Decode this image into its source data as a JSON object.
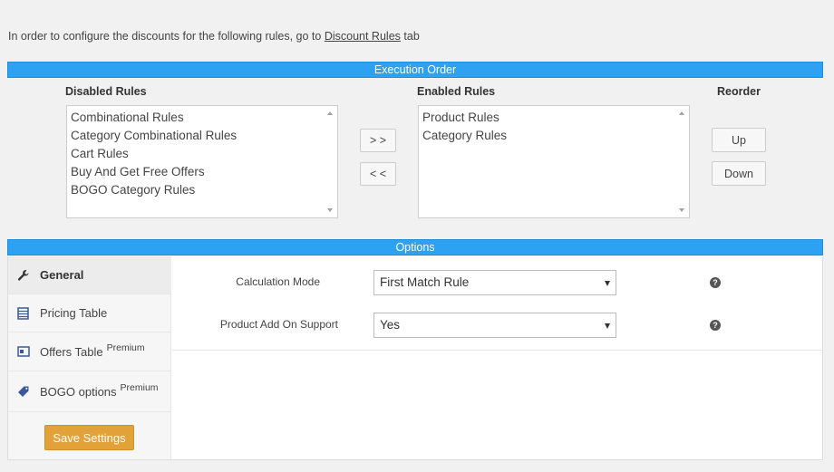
{
  "intro": {
    "prefix": "In order to configure the discounts for the following rules, go to",
    "link": "Discount Rules",
    "suffix": "tab"
  },
  "execution_order": {
    "title": "Execution Order",
    "disabled_heading": "Disabled Rules",
    "enabled_heading": "Enabled Rules",
    "reorder_heading": "Reorder",
    "disabled_rules": [
      "Combinational Rules",
      "Category Combinational Rules",
      "Cart Rules",
      "Buy And Get Free Offers",
      "BOGO Category Rules"
    ],
    "enabled_rules": [
      "Product Rules",
      "Category Rules"
    ],
    "move_right_label": "> >",
    "move_left_label": "< <",
    "up_label": "Up",
    "down_label": "Down"
  },
  "options": {
    "title": "Options",
    "tabs": [
      {
        "label": "General",
        "icon": "wrench-icon",
        "premium": ""
      },
      {
        "label": "Pricing Table",
        "icon": "table-icon",
        "premium": ""
      },
      {
        "label": "Offers Table",
        "icon": "offers-table-icon",
        "premium": "Premium"
      },
      {
        "label": "BOGO options",
        "icon": "tag-icon",
        "premium": "Premium"
      }
    ],
    "save_label": "Save Settings",
    "fields": [
      {
        "label": "Calculation Mode",
        "value": "First Match Rule"
      },
      {
        "label": "Product Add On Support",
        "value": "Yes"
      }
    ],
    "help_glyph": "?"
  }
}
